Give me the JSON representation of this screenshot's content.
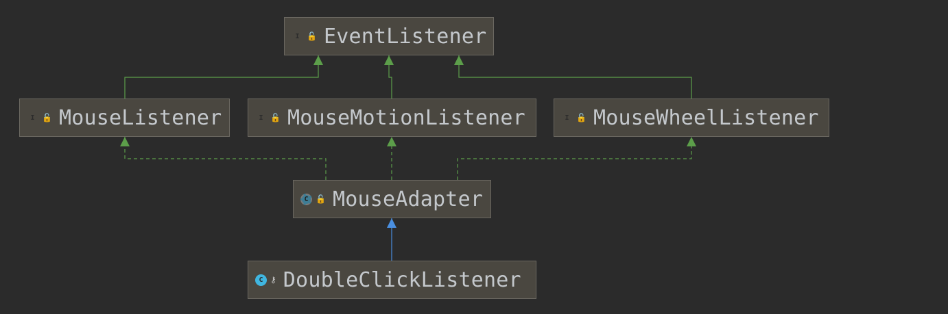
{
  "diagram": {
    "colors": {
      "background": "#2b2b2b",
      "node_fill": "#4a4740",
      "node_border": "#6b6861",
      "label_text": "#c4c8cc",
      "interface_edge": "#5c9e4a",
      "extends_edge": "#4a8fe0"
    },
    "nodes": [
      {
        "id": "eventlistener",
        "label": "EventListener",
        "kind": "interface",
        "kind_glyph": "I",
        "kind_icon": "interface-icon",
        "access": "public",
        "access_icon": "unlock-icon"
      },
      {
        "id": "mouselistener",
        "label": "MouseListener",
        "kind": "interface",
        "kind_glyph": "I",
        "kind_icon": "interface-icon",
        "access": "public",
        "access_icon": "unlock-icon"
      },
      {
        "id": "mousemotionlistener",
        "label": "MouseMotionListener",
        "kind": "interface",
        "kind_glyph": "I",
        "kind_icon": "interface-icon",
        "access": "public",
        "access_icon": "unlock-icon"
      },
      {
        "id": "mousewheellistener",
        "label": "MouseWheelListener",
        "kind": "interface",
        "kind_glyph": "I",
        "kind_icon": "interface-icon",
        "access": "public",
        "access_icon": "unlock-icon"
      },
      {
        "id": "mouseadapter",
        "label": "MouseAdapter",
        "kind": "abstract-class",
        "kind_glyph": "C",
        "kind_icon": "abstract-class-icon",
        "access": "public",
        "access_icon": "unlock-icon"
      },
      {
        "id": "doubleclicklistener",
        "label": "DoubleClickListener",
        "kind": "class",
        "kind_glyph": "C",
        "kind_icon": "class-icon",
        "access": "private",
        "access_icon": "key-icon"
      }
    ],
    "edges": [
      {
        "from": "mouselistener",
        "to": "eventlistener",
        "type": "extends-interface"
      },
      {
        "from": "mousemotionlistener",
        "to": "eventlistener",
        "type": "extends-interface"
      },
      {
        "from": "mousewheellistener",
        "to": "eventlistener",
        "type": "extends-interface"
      },
      {
        "from": "mouseadapter",
        "to": "mouselistener",
        "type": "implements"
      },
      {
        "from": "mouseadapter",
        "to": "mousemotionlistener",
        "type": "implements"
      },
      {
        "from": "mouseadapter",
        "to": "mousewheellistener",
        "type": "implements"
      },
      {
        "from": "doubleclicklistener",
        "to": "mouseadapter",
        "type": "extends-class"
      }
    ]
  }
}
